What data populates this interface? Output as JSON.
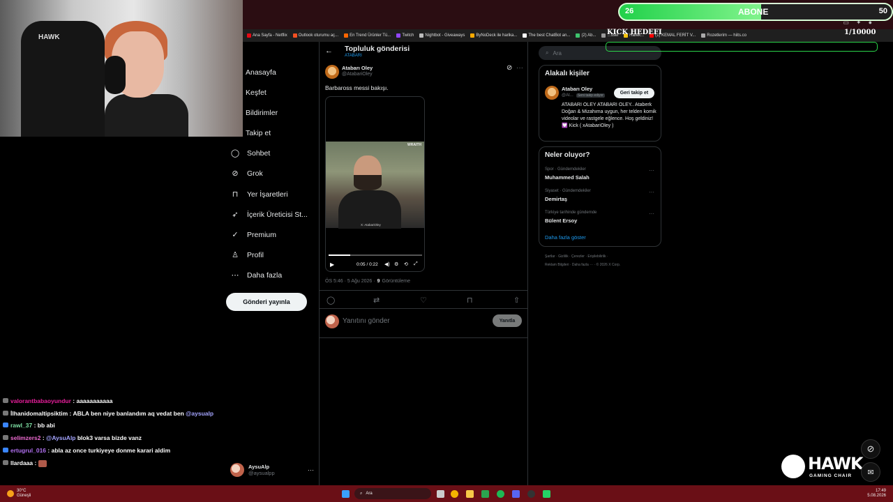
{
  "overlay": {
    "sub_goal_current": "26",
    "sub_goal_label": "ABONE",
    "sub_goal_target": "50",
    "sub_goal_progress": 0.52,
    "kick_goal_label": "KICK HEDEFI",
    "kick_goal_value": "1/10000",
    "hawk_brand": "HAWK",
    "hawk_sub": "GAMING CHAIR"
  },
  "webcam": {
    "chair_logo": "HAWK"
  },
  "bookmarks": [
    {
      "label": "Ana Sayfa - Netflix",
      "color": "#e50914"
    },
    {
      "label": "Outlook oturumu aç...",
      "color": "#f25022"
    },
    {
      "label": "En Trend Ürünler Tü...",
      "color": "#ff6600"
    },
    {
      "label": "Twitch",
      "color": "#9146ff"
    },
    {
      "label": "Nightbot - Giveaways",
      "color": "#bbbbbb"
    },
    {
      "label": "ByNoDeck ile harika...",
      "color": "#ffaa00"
    },
    {
      "label": "The best ChatBot an...",
      "color": "#ffffff"
    },
    {
      "label": "(2) Ab...",
      "color": "#3ec46d"
    },
    {
      "label": "...ssel",
      "color": "#999999"
    },
    {
      "label": "Harek...",
      "color": "#f4c20d"
    },
    {
      "label": "(1) KEMAL FERİT V...",
      "color": "#ff0000"
    },
    {
      "label": "Rozetlerim — hiits.co",
      "color": "#aaaaaa"
    }
  ],
  "nav": {
    "items": [
      {
        "label": "Anasayfa",
        "icon": "home-icon",
        "glyph": ""
      },
      {
        "label": "Keşfet",
        "icon": "explore-icon",
        "glyph": ""
      },
      {
        "label": "Bildirimler",
        "icon": "bell-icon",
        "glyph": ""
      },
      {
        "label": "Takip et",
        "icon": "follow-icon",
        "glyph": ""
      },
      {
        "label": "Sohbet",
        "icon": "chat-icon",
        "glyph": "◯"
      },
      {
        "label": "Grok",
        "icon": "grok-icon",
        "glyph": "⊘"
      },
      {
        "label": "Yer İşaretleri",
        "icon": "bookmark-icon",
        "glyph": "⊓"
      },
      {
        "label": "İçerik Üreticisi St...",
        "icon": "rocket-icon",
        "glyph": "➶"
      },
      {
        "label": "Premium",
        "icon": "premium-icon",
        "glyph": "✓"
      },
      {
        "label": "Profil",
        "icon": "profile-icon",
        "glyph": "♙"
      },
      {
        "label": "Daha fazla",
        "icon": "more-icon",
        "glyph": "⋯"
      }
    ],
    "post_button": "Gönderi yayınla",
    "account_name": "AysuAlp",
    "account_handle": "@aysualpp",
    "account_more": "···"
  },
  "main": {
    "header_title": "Topluluk gönderisi",
    "header_sub": "ATABARI",
    "author_name": "Atabarı Oley",
    "author_handle": "@AtabariOley",
    "tweet_text": "Barbaross messi bakışı.",
    "video_watermark_top": "WRAITH",
    "video_watermark_bottom": "X: AtabariOley",
    "video_time": "0:05 / 0:22",
    "video_progress": 0.23,
    "meta_time": "ÖS 5:46 · 5 Ağu 2026 ·",
    "meta_views_count": "9",
    "meta_views_label": "Görüntüleme",
    "reply_placeholder": "Yanıtını gönder",
    "reply_button": "Yanıtla"
  },
  "sidebar": {
    "search_placeholder": "Ara",
    "related_title": "Alakalı kişiler",
    "related_name": "Atabarı Oley",
    "related_handle": "@At...",
    "related_badge": "Seni takip ediyor",
    "follow_button": "Geri takip et",
    "related_bio": "ATABARI OLEY ATABARI OLEY.. Ataberk Doğan & Mizahıma uygun, her telden komik videolar ve rastgele eğlence. Hoş geldiniz! 💟 Kick ( xAtabariOley )",
    "trends_title": "Neler oluyor?",
    "trends": [
      {
        "category": "Spor · Gündemdekiler",
        "name": "Muhammed Salah"
      },
      {
        "category": "Siyaset · Gündemdekiler",
        "name": "Demirtaş"
      },
      {
        "category": "Türkiye tarihinde gündemde",
        "name": "Bülent Ersoy"
      }
    ],
    "show_more": "Daha fazla göster",
    "footer_1": "Şartlar · Gizlilik · Çerezler · Erişilebilirlik ·",
    "footer_2": "Reklam Bilgileri · Daha fazla ··· · © 2026 X Corp."
  },
  "chat": [
    {
      "user": "valorantbabaoyundur",
      "color": "#e91e9c",
      "message": "aaaaaaaaaaa",
      "mention": ""
    },
    {
      "user": "İlhanidomaltipsiktim",
      "color": "#ffffff",
      "message": "ABLA ben niye banlandım aq vedat ben ",
      "mention": "@aysualp"
    },
    {
      "user": "rawl_37",
      "color": "#7ee0a4",
      "message": "bb abi",
      "mention": ""
    },
    {
      "user": "selimzers2",
      "color": "#f06cd3",
      "message": "",
      "mention": "@AysuAlp",
      "message_after": " blok3 varsa bizde vanz"
    },
    {
      "user": "ertugrul_016",
      "color": "#b070f0",
      "message": "abla az once turkiyeye donme karari aldim",
      "mention": ""
    },
    {
      "user": "llardaaa",
      "color": "#ffffff",
      "message": "",
      "mention": ""
    }
  ],
  "taskbar": {
    "weather_temp": "30°C",
    "weather_desc": "Güneşli",
    "search_label": "Ara",
    "time": "17:49",
    "date": "5.08.2026"
  }
}
